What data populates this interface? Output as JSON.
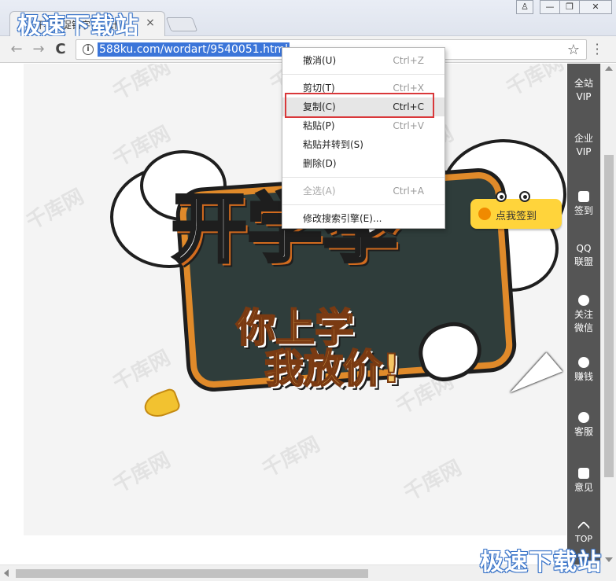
{
  "browser": {
    "tab_title": "开学季促销字体设计",
    "tab_close": "×",
    "window_buttons": {
      "user": "♙",
      "minimize": "—",
      "restore": "❐",
      "close": "✕"
    },
    "nav": {
      "back": "←",
      "forward": "→",
      "reload": "C"
    },
    "url": "588ku.com/wordart/9540051.html",
    "star": "☆",
    "menu": "⋮"
  },
  "watermarks": {
    "site_top": "极速下载站",
    "site_bottom": "极速下载站",
    "content_mark": "千库网"
  },
  "poster": {
    "headline": "开学季",
    "line1": "你上学",
    "line2": "我放价!"
  },
  "sign_badge": {
    "label": "点我签到"
  },
  "side_panel": {
    "items": [
      {
        "line1": "全站",
        "line2": "VIP",
        "icon": "none"
      },
      {
        "line1": "企业",
        "line2": "VIP",
        "icon": "none"
      },
      {
        "line1": "签到",
        "line2": "",
        "icon": "calendar-icon"
      },
      {
        "line1": "QQ",
        "line2": "联盟",
        "icon": "none"
      },
      {
        "line1": "关注",
        "line2": "微信",
        "icon": "wechat-icon"
      },
      {
        "line1": "赚钱",
        "line2": "",
        "icon": "money-bag-icon"
      },
      {
        "line1": "客服",
        "line2": "",
        "icon": "headset-icon"
      },
      {
        "line1": "意见",
        "line2": "",
        "icon": "thumbs-up-icon"
      },
      {
        "line1": "TOP",
        "line2": "",
        "icon": "chevron-up-icon"
      }
    ]
  },
  "context_menu": {
    "items": [
      {
        "label": "撤消(U)",
        "shortcut": "Ctrl+Z",
        "disabled": false
      },
      {
        "label": "剪切(T)",
        "shortcut": "Ctrl+X",
        "disabled": false
      },
      {
        "label": "复制(C)",
        "shortcut": "Ctrl+C",
        "disabled": false,
        "highlighted": true
      },
      {
        "label": "粘贴(P)",
        "shortcut": "Ctrl+V",
        "disabled": false
      },
      {
        "label": "粘贴并转到(S)",
        "shortcut": "",
        "disabled": false
      },
      {
        "label": "删除(D)",
        "shortcut": "",
        "disabled": false
      },
      {
        "label": "全选(A)",
        "shortcut": "Ctrl+A",
        "disabled": true
      },
      {
        "label": "修改搜索引擎(E)...",
        "shortcut": "",
        "disabled": false
      }
    ]
  },
  "colors": {
    "url_selection": "#3b75d9",
    "highlight_border": "#d9383a",
    "side_panel_bg": "#555555",
    "badge_yellow": "#ffd43b"
  }
}
